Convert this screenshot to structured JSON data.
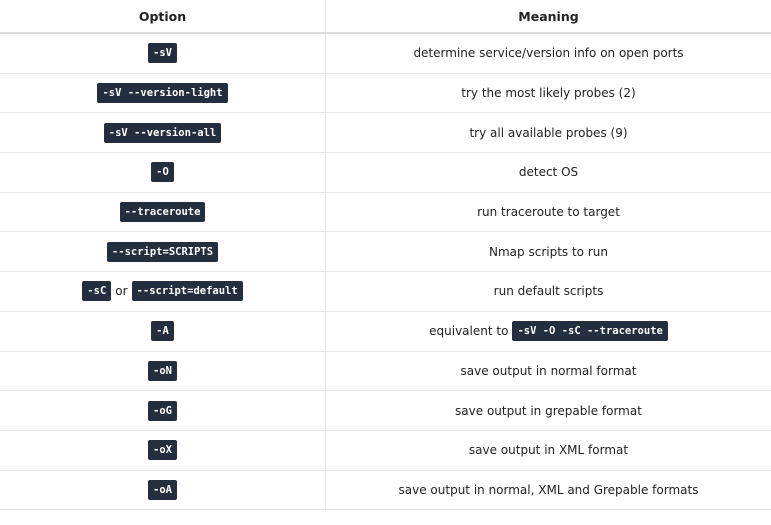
{
  "header": {
    "option": "Option",
    "meaning": "Meaning"
  },
  "rows": [
    {
      "option": "-sV",
      "meaning": "determine service/version info on open ports"
    },
    {
      "option": "-sV --version-light",
      "meaning": "try the most likely probes (2)"
    },
    {
      "option": "-sV --version-all",
      "meaning": "try all available probes (9)"
    },
    {
      "option": "-O",
      "meaning": "detect OS"
    },
    {
      "option": "--traceroute",
      "meaning": "run traceroute to target"
    },
    {
      "option": "--script=SCRIPTS",
      "meaning": "Nmap scripts to run"
    },
    {
      "option_a": "-sC",
      "option_sep": "or",
      "option_b": "--script=default",
      "meaning": "run default scripts"
    },
    {
      "option": "-A",
      "meaning_prefix": "equivalent to",
      "meaning_code": "-sV -O -sC --traceroute"
    },
    {
      "option": "-oN",
      "meaning": "save output in normal format"
    },
    {
      "option": "-oG",
      "meaning": "save output in grepable format"
    },
    {
      "option": "-oX",
      "meaning": "save output in XML format"
    },
    {
      "option": "-oA",
      "meaning": "save output in normal, XML and Grepable formats"
    }
  ]
}
